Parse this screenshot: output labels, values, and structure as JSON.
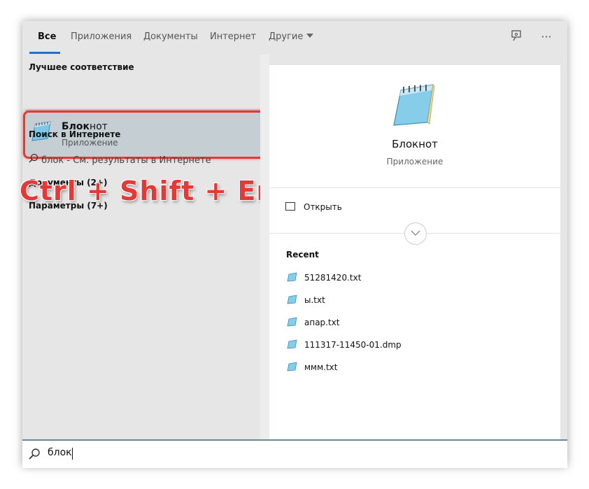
{
  "tabs": [
    {
      "label": "Все"
    },
    {
      "label": "Приложения"
    },
    {
      "label": "Документы"
    },
    {
      "label": "Интернет"
    },
    {
      "label": "Другие"
    }
  ],
  "header_icons": [
    "feedback-icon",
    "more-icon"
  ],
  "more_label": "···",
  "left": {
    "best_match_header": "Лучшее соответствие",
    "best_match": {
      "title_bold": "Блок",
      "title_rest": "нот",
      "subtitle": "Приложение"
    },
    "web_header": "Поиск в Интернете",
    "web_query": "блок",
    "web_suffix": " - См. результаты в Интернете",
    "documents": "Документы (2+)",
    "settings": "Параметры (7+)"
  },
  "overlay_shortcut": "Ctrl + Shift + Enter",
  "right": {
    "title": "Блокнот",
    "subtitle": "Приложение",
    "open_label": "Открыть",
    "recent_header": "Recent",
    "recent_items": [
      "51281420.txt",
      "ы.txt",
      "апар.txt",
      "111317-11450-01.dmp",
      "ммм.txt"
    ]
  },
  "search": {
    "value": "блок"
  },
  "colors": {
    "accent": "#1f6fd1",
    "highlight_red": "#e53935"
  }
}
